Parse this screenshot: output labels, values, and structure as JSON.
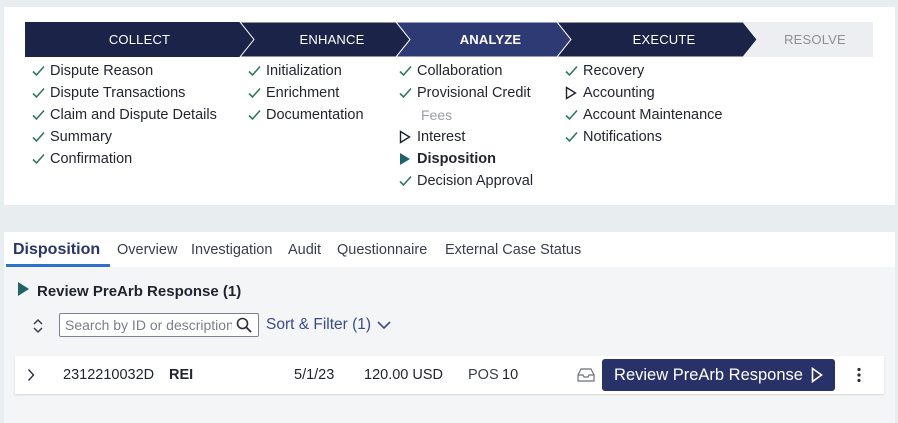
{
  "stages": [
    {
      "label": "COLLECT",
      "state": "done"
    },
    {
      "label": "ENHANCE",
      "state": "done"
    },
    {
      "label": "ANALYZE",
      "state": "active"
    },
    {
      "label": "EXECUTE",
      "state": "done"
    },
    {
      "label": "RESOLVE",
      "state": "pending"
    }
  ],
  "columns": [
    [
      {
        "label": "Dispute Reason",
        "status": "done"
      },
      {
        "label": "Dispute Transactions",
        "status": "done"
      },
      {
        "label": "Claim and Dispute Details",
        "status": "done"
      },
      {
        "label": "Summary",
        "status": "done"
      },
      {
        "label": "Confirmation",
        "status": "done"
      }
    ],
    [
      {
        "label": "Initialization",
        "status": "done"
      },
      {
        "label": "Enrichment",
        "status": "done"
      },
      {
        "label": "Documentation",
        "status": "done"
      }
    ],
    [
      {
        "label": "Collaboration",
        "status": "done"
      },
      {
        "label": "Provisional Credit",
        "status": "done"
      },
      {
        "label": "Fees",
        "status": "disabled"
      },
      {
        "label": "Interest",
        "status": "pending"
      },
      {
        "label": "Disposition",
        "status": "current"
      },
      {
        "label": "Decision Approval",
        "status": "done"
      }
    ],
    [
      {
        "label": "Recovery",
        "status": "done"
      },
      {
        "label": "Accounting",
        "status": "pending"
      },
      {
        "label": "Account Maintenance",
        "status": "done"
      },
      {
        "label": "Notifications",
        "status": "done"
      }
    ]
  ],
  "tabs": [
    "Disposition",
    "Overview",
    "Investigation",
    "Audit",
    "Questionnaire",
    "External Case Status"
  ],
  "section": {
    "title": "Review PreArb Response (1)"
  },
  "search": {
    "placeholder": "Search by ID or description"
  },
  "sort_filter_label": "Sort & Filter (1)",
  "row": {
    "id": "2312210032D",
    "code": "REI",
    "date": "5/1/23",
    "amount": "120.00 USD",
    "type": "POS",
    "num": "10",
    "action": "Review PreArb Response"
  },
  "colors": {
    "navy": "#1c2349",
    "active": "#2e3a73",
    "pending_bg": "#eceef1",
    "check": "#2f7a5f",
    "teal": "#20636b"
  },
  "icons": {
    "done": "check-icon",
    "pending": "outline-play-icon",
    "current": "filled-play-icon",
    "search": "search-icon",
    "sort": "sort-arrows-icon",
    "expand": "chevron-right-icon",
    "inbox": "inbox-icon",
    "more": "more-vertical-icon"
  }
}
